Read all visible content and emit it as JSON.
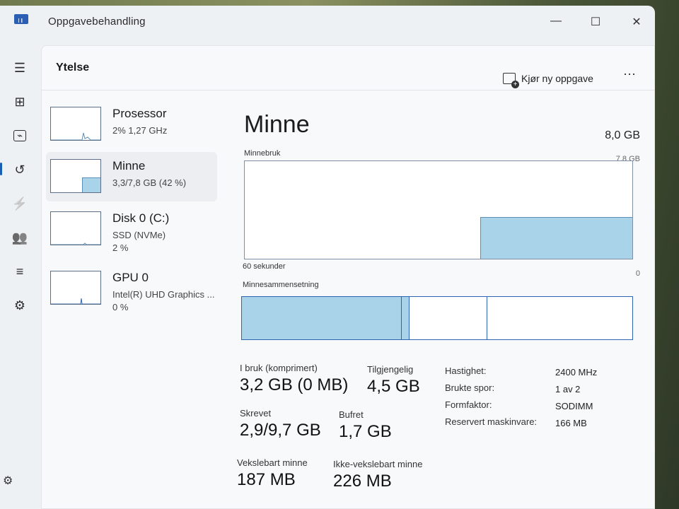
{
  "window": {
    "title": "Oppgavebehandling",
    "minimize": "—",
    "maximize": "☐",
    "close": "✕"
  },
  "page": {
    "title": "Ytelse",
    "run_new_task": "Kjør ny oppgave",
    "more": "⋯"
  },
  "nav": [
    {
      "name": "hamburger-icon",
      "glyph": "☰"
    },
    {
      "name": "processes-icon",
      "glyph": "⊞"
    },
    {
      "name": "performance-icon",
      "glyph": "⌁"
    },
    {
      "name": "app-history-icon",
      "glyph": "↺"
    },
    {
      "name": "startup-apps-icon",
      "glyph": "⚡"
    },
    {
      "name": "users-icon",
      "glyph": "👥"
    },
    {
      "name": "details-icon",
      "glyph": "≡"
    },
    {
      "name": "services-icon",
      "glyph": "⚙"
    }
  ],
  "settings_glyph": "⚙",
  "devices": [
    {
      "name": "Prosessor",
      "sub": "2%  1,27 GHz",
      "sub2": ""
    },
    {
      "name": "Minne",
      "sub": "3,3/7,8 GB (42 %)",
      "sub2": ""
    },
    {
      "name": "Disk 0 (C:)",
      "sub": "SSD (NVMe)",
      "sub2": "2 %"
    },
    {
      "name": "GPU 0",
      "sub": "Intel(R) UHD Graphics ...",
      "sub2": "0 %"
    }
  ],
  "memory": {
    "title": "Minne",
    "total": "8,0 GB",
    "usage_label": "Minnebruk",
    "usage_max": "7,8 GB",
    "time_label": "60 sekunder",
    "min_label": "0",
    "composition_label": "Minnesammensetning",
    "usage_level": 0.42,
    "composition": {
      "in_use": 0.41,
      "modified": 0.02,
      "standby": 0.2
    },
    "stats": {
      "in_use_label": "I bruk (komprimert)",
      "in_use_value": "3,2 GB (0 MB)",
      "available_label": "Tilgjengelig",
      "available_value": "4,5 GB",
      "committed_label": "Skrevet",
      "committed_value": "2,9/9,7 GB",
      "cached_label": "Bufret",
      "cached_value": "1,7 GB",
      "paged_label": "Vekslebart minne",
      "paged_value": "187 MB",
      "nonpaged_label": "Ikke-vekslebart minne",
      "nonpaged_value": "226 MB"
    },
    "specs": [
      {
        "k": "Hastighet:",
        "v": "2400 MHz"
      },
      {
        "k": "Brukte spor:",
        "v": "1 av 2"
      },
      {
        "k": "Formfaktor:",
        "v": "SODIMM"
      },
      {
        "k": "Reservert maskinvare:",
        "v": "166 MB"
      }
    ]
  },
  "colors": {
    "accent": "#2f64b3",
    "fill": "#a8d3e9"
  }
}
